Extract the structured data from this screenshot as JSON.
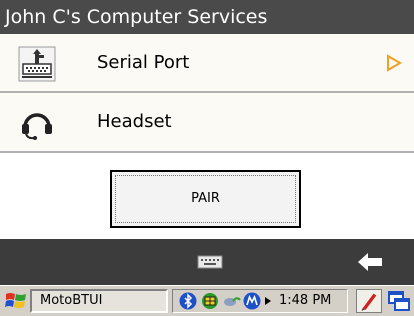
{
  "title": "John C's Computer Services",
  "list": {
    "items": [
      {
        "label": "Serial Port",
        "icon": "serial-port-icon",
        "chevron": "chevron-right-icon"
      },
      {
        "label": "Headset",
        "icon": "headset-icon"
      }
    ]
  },
  "pair_button": {
    "label": "PAIR"
  },
  "softbar": {
    "keyboard_icon": "keyboard-icon",
    "back_icon": "back-arrow-icon"
  },
  "taskbar": {
    "start_icon": "windows-start-icon",
    "task_label": "MotoBTUI",
    "tray_icons": [
      "bluetooth-icon",
      "network-icon",
      "connection-icon",
      "motorola-icon"
    ],
    "time": "1:48 PM",
    "pen_icon": "pen-input-icon",
    "window_icon": "window-switch-icon"
  },
  "colors": {
    "title_bg": "#4a4a4a",
    "softbar_bg": "#3c3c3c",
    "chevron": "#f0a020",
    "taskbar_bg": "#d4d0c8"
  }
}
